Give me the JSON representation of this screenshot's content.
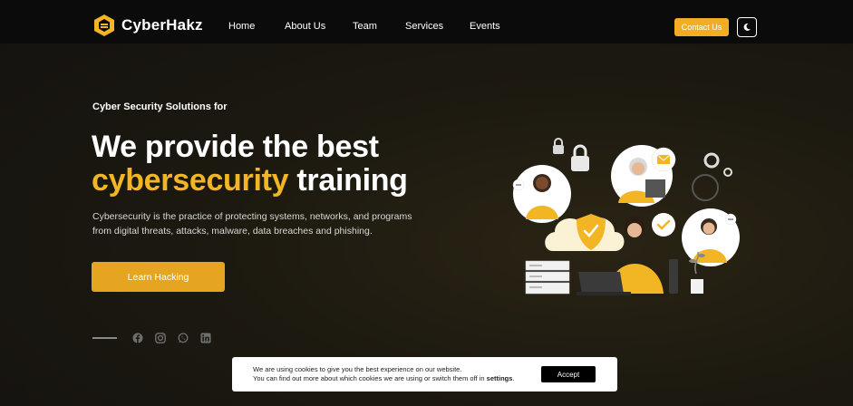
{
  "brand": {
    "name": "CyberHakz",
    "accent": "#f2b523"
  },
  "nav": {
    "items": [
      {
        "label": "Home"
      },
      {
        "label": "About Us"
      },
      {
        "label": "Team"
      },
      {
        "label": "Services"
      },
      {
        "label": "Events"
      }
    ],
    "contact_label": "Contact Us",
    "theme_icon": "moon-icon"
  },
  "hero": {
    "eyebrow": "Cyber Security Solutions for",
    "title_line1": "We provide the best",
    "title_accent": "cybersecurity",
    "title_rest": "training",
    "description": "Cybersecurity is the practice of protecting systems, networks, and programs from digital threats, attacks, malware, data breaches and phishing.",
    "cta_label": "Learn Hacking"
  },
  "social": {
    "icons": [
      "facebook-icon",
      "instagram-icon",
      "whatsapp-icon",
      "linkedin-icon"
    ]
  },
  "cookie": {
    "line1": "We are using cookies to give you the best experience on our website.",
    "line2_prefix": "You can find out more about which cookies we are using or switch them off in",
    "line2_link": "settings",
    "line2_suffix": ".",
    "accept_label": "Accept"
  }
}
